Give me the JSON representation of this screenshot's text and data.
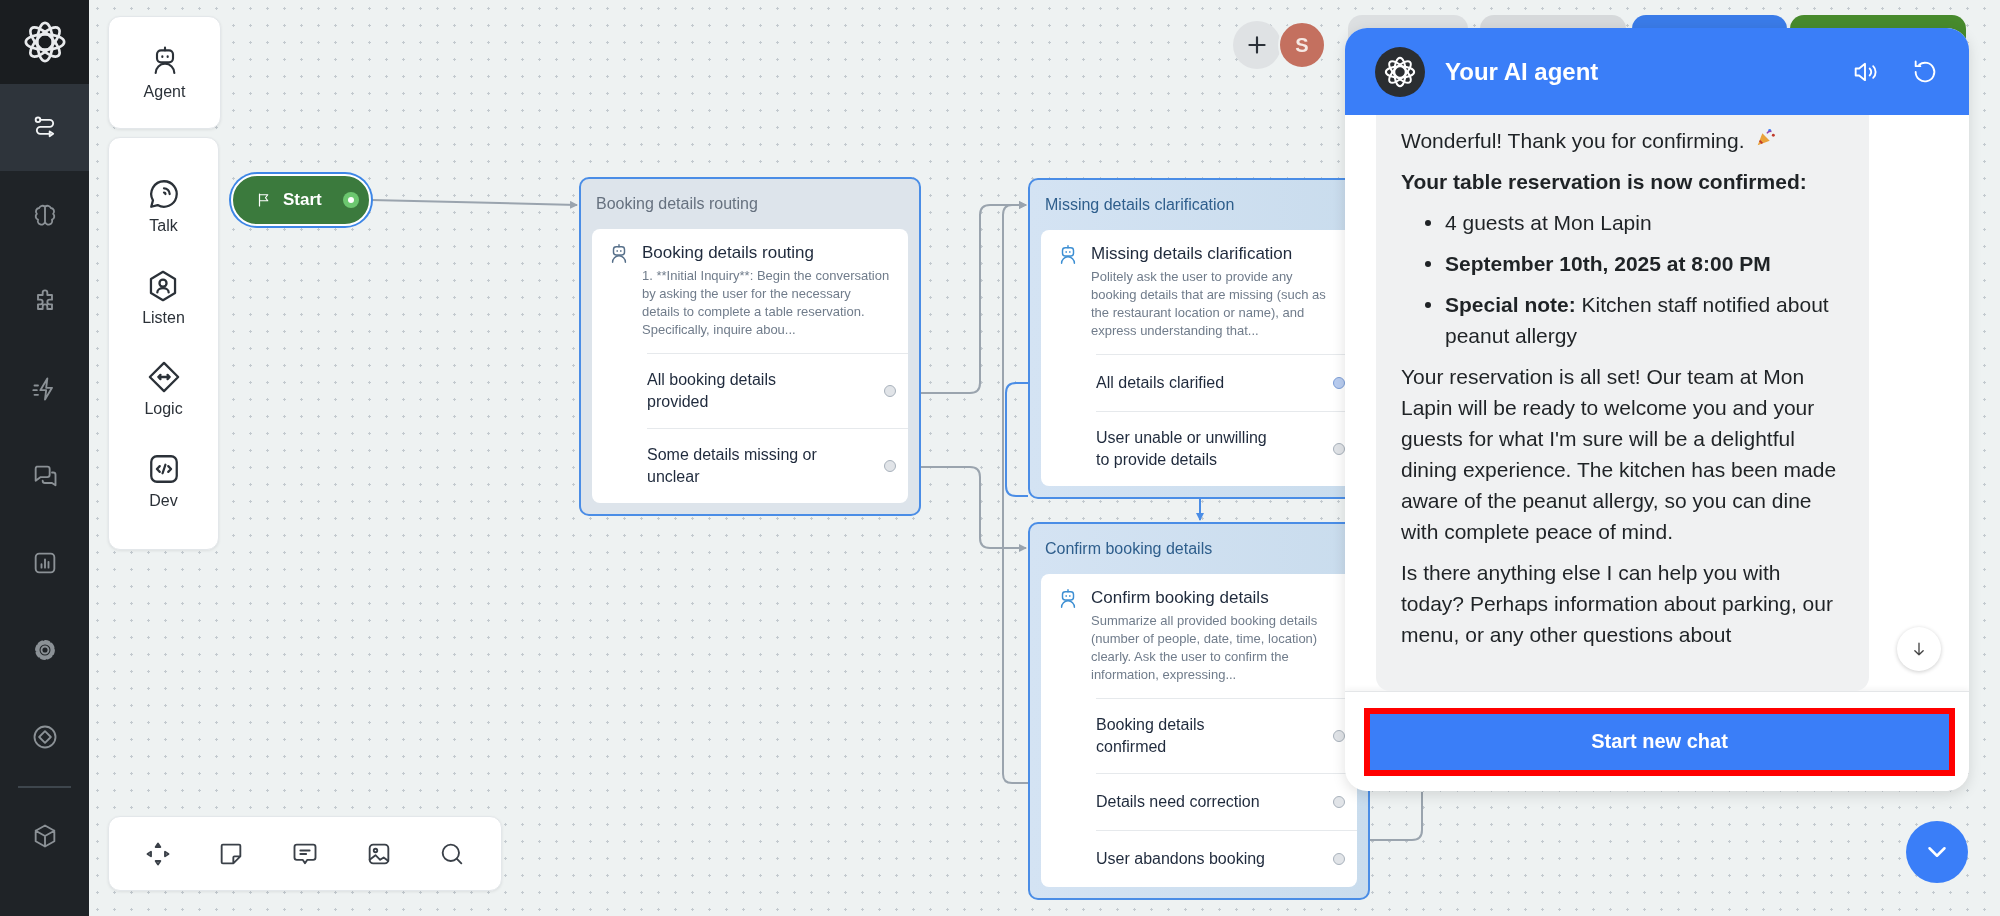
{
  "sidebar": {
    "items": [
      {
        "selected": true
      },
      {
        "selected": false
      },
      {
        "selected": false
      },
      {
        "selected": false
      },
      {
        "selected": false
      },
      {
        "selected": false
      },
      {
        "selected": false
      },
      {
        "selected": false
      },
      {
        "selected": false
      }
    ]
  },
  "palette": {
    "agent": {
      "label": "Agent"
    },
    "tools": [
      {
        "label": "Talk"
      },
      {
        "label": "Listen"
      },
      {
        "label": "Logic"
      },
      {
        "label": "Dev"
      }
    ]
  },
  "collaborators": {
    "avatar": {
      "initial": "S"
    }
  },
  "canvas": {
    "start": {
      "label": "Start"
    },
    "nodes": [
      {
        "title": "Booking details routing",
        "active": false,
        "card": {
          "title": "Booking details routing",
          "description": "1. **Initial Inquiry**: Begin the conversation by asking the user for the necessary details to complete a table reservation. Specifically, inquire abou..."
        },
        "outputs": [
          {
            "label": "All booking details provided",
            "highlighted": false
          },
          {
            "label": "Some details missing or unclear",
            "highlighted": false
          }
        ]
      },
      {
        "title": "Missing details clarification",
        "active": true,
        "card": {
          "title": "Missing details clarification",
          "description": "Politely ask the user to provide any booking details that are missing (such as the restaurant location or name), and express understanding that..."
        },
        "outputs": [
          {
            "label": "All details clarified",
            "highlighted": true
          },
          {
            "label": "User unable or unwilling to provide details",
            "highlighted": false
          }
        ]
      },
      {
        "title": "Confirm booking details",
        "active": true,
        "card": {
          "title": "Confirm booking details",
          "description": "Summarize all provided booking details (number of people, date, time, location) clearly. Ask the user to confirm the information, expressing..."
        },
        "outputs": [
          {
            "label": "Booking details confirmed",
            "highlighted": false
          },
          {
            "label": "Details need correction",
            "highlighted": false
          },
          {
            "label": "User abandons booking",
            "highlighted": false
          }
        ]
      }
    ]
  },
  "chat": {
    "title": "Your AI agent",
    "blocks": [
      {
        "kind": "paragraph",
        "text": "Wonderful! Thank you for confirming."
      },
      {
        "kind": "heading",
        "text": "Your table reservation is now confirmed:"
      },
      {
        "kind": "bullets",
        "items": [
          "4 guests at Mon Lapin",
          "**September 10th, 2025 at 8:00 PM**",
          "**Special note:** Kitchen staff notified about peanut allergy"
        ]
      },
      {
        "kind": "paragraph",
        "text": "Your reservation is all set! Our team at Mon Lapin will be ready to welcome you and your guests for what I'm sure will be a delightful dining experience. The kitchen has been made aware of the peanut allergy, so you can dine with complete peace of mind."
      },
      {
        "kind": "paragraph",
        "text": "Is there anything else I can help you with today? Perhaps information about parking, our menu, or any other questions about"
      }
    ],
    "button": {
      "label": "Start new chat",
      "highlighted": true
    }
  }
}
